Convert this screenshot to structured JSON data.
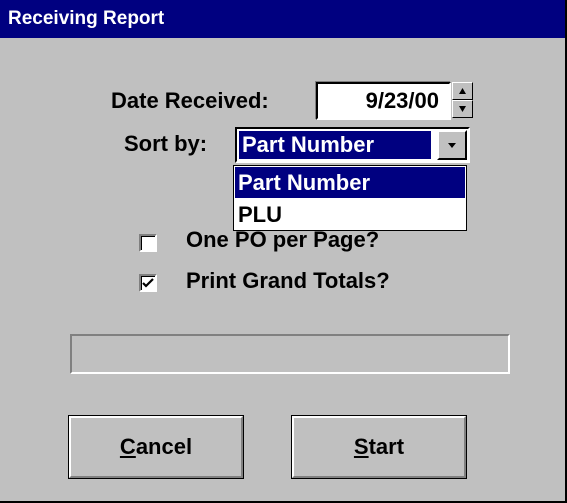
{
  "window": {
    "title": "Receiving Report"
  },
  "date_received": {
    "label": "Date Received:",
    "value": "9/23/00"
  },
  "sort_by": {
    "label": "Sort by:",
    "selected": "Part Number",
    "options": [
      "Part Number",
      "PLU"
    ]
  },
  "options": {
    "one_po_per_page": {
      "label": "One PO per Page?",
      "checked": false
    },
    "print_grand_totals": {
      "label": "Print Grand Totals?",
      "checked": true
    }
  },
  "progress": {
    "value": 0
  },
  "buttons": {
    "cancel": {
      "mnemonic": "C",
      "rest": "ancel"
    },
    "start": {
      "mnemonic": "S",
      "rest": "tart"
    }
  },
  "colors": {
    "face": "#c0c0c0",
    "title_bar": "#000080",
    "selection": "#000080"
  }
}
